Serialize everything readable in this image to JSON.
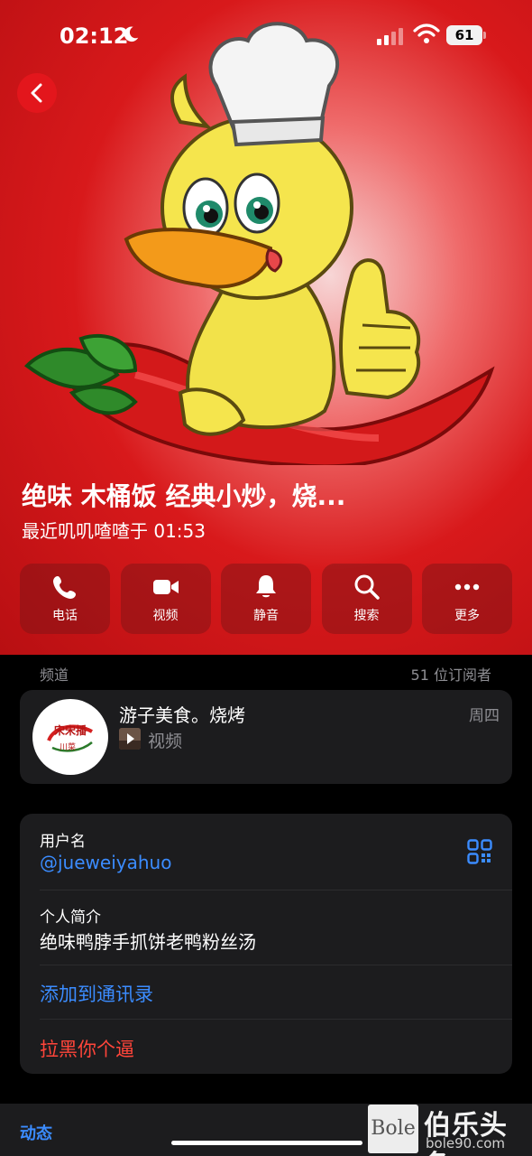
{
  "status_bar": {
    "time": "02:12",
    "battery": "61"
  },
  "profile": {
    "name": "绝味 木桶饭 经典小炒，烧...",
    "last_seen": "最近叽叽喳喳于 01:53"
  },
  "actions": [
    {
      "label": "电话",
      "icon": "phone-icon"
    },
    {
      "label": "视频",
      "icon": "video-camera-icon"
    },
    {
      "label": "静音",
      "icon": "bell-icon"
    },
    {
      "label": "搜索",
      "icon": "search-icon"
    },
    {
      "label": "更多",
      "icon": "more-dots-icon"
    }
  ],
  "channel_section": {
    "title": "频道",
    "subscribers": "51 位订阅者"
  },
  "channel": {
    "name": "游子美食。烧烤",
    "day": "周四",
    "subtitle": "视频",
    "avatar_text_1": "宋宋播",
    "avatar_text_2": "川菜"
  },
  "info": {
    "username_label": "用户名",
    "username": "@jueweiyahuo",
    "bio_label": "个人简介",
    "bio": "绝味鸭脖手抓饼老鸭粉丝汤",
    "add_contact": "添加到通讯录",
    "block": "拉黑你个逼"
  },
  "bottom": {
    "tab_label": "动态"
  },
  "watermark": {
    "logo": "Bole",
    "title": "伯乐头条",
    "url": "bole90.com"
  },
  "colors": {
    "accent_blue": "#3b8cff",
    "destructive_red": "#ff453a",
    "header_red": "#d8191b",
    "card_bg": "#1c1c1e"
  }
}
